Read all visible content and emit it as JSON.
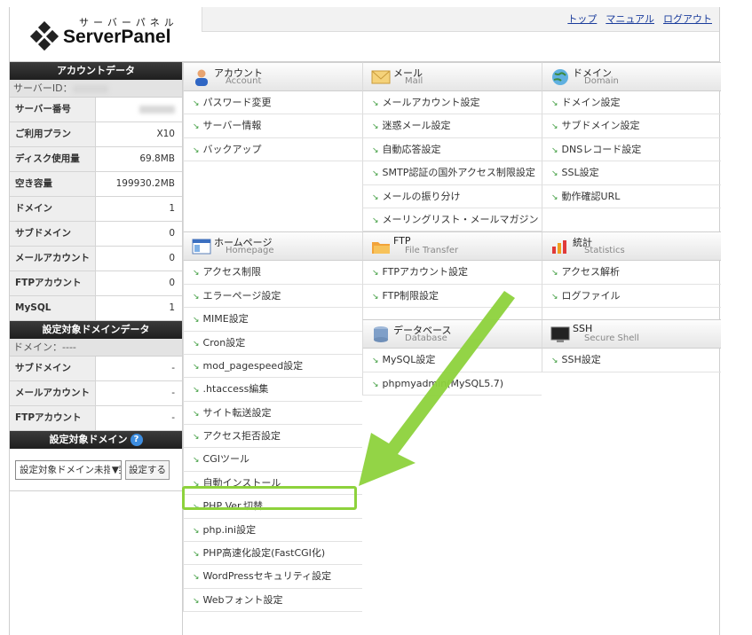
{
  "header": {
    "logo_kana": "サーバーパネル",
    "logo_text": "ServerPanel",
    "links": [
      "トップ",
      "マニュアル",
      "ログアウト"
    ]
  },
  "sidebar": {
    "account_title": "アカウントデータ",
    "server_id_label": "サーバーID：",
    "rows": [
      {
        "k": "サーバー番号",
        "v": ""
      },
      {
        "k": "ご利用プラン",
        "v": "X10"
      },
      {
        "k": "ディスク使用量",
        "v": "69.8MB"
      },
      {
        "k": "空き容量",
        "v": "199930.2MB"
      },
      {
        "k": "ドメイン",
        "v": "1"
      },
      {
        "k": "サブドメイン",
        "v": "0"
      },
      {
        "k": "メールアカウント",
        "v": "0"
      },
      {
        "k": "FTPアカウント",
        "v": "0"
      },
      {
        "k": "MySQL",
        "v": "1"
      }
    ],
    "domain_data_title": "設定対象ドメインデータ",
    "domain_label": "ドメイン：----",
    "domain_rows": [
      {
        "k": "サブドメイン",
        "v": "-"
      },
      {
        "k": "メールアカウント",
        "v": "-"
      },
      {
        "k": "FTPアカウント",
        "v": "-"
      }
    ],
    "target_domain_title": "設定対象ドメイン",
    "help": "?",
    "select_value": "設定対象ドメイン未指定",
    "select_arrow": "▼",
    "set_button": "設定する"
  },
  "columns": [
    {
      "sections": [
        {
          "title": "アカウント",
          "sub": "Account",
          "icon": "user-icon",
          "items": [
            "パスワード変更",
            "サーバー情報",
            "バックアップ"
          ],
          "pad": 3
        },
        {
          "title": "ホームページ",
          "sub": "Homepage",
          "icon": "homepage-icon",
          "items": [
            "アクセス制限",
            "エラーページ設定",
            "MIME設定",
            "Cron設定",
            "mod_pagespeed設定",
            ".htaccess編集",
            "サイト転送設定",
            "アクセス拒否設定",
            "CGIツール",
            "自動インストール",
            "PHP Ver.切替",
            "php.ini設定",
            "PHP高速化設定(FastCGI化)",
            "WordPressセキュリティ設定",
            "Webフォント設定"
          ],
          "pad": 0
        }
      ]
    },
    {
      "sections": [
        {
          "title": "メール",
          "sub": "Mail",
          "icon": "mail-icon",
          "items": [
            "メールアカウント設定",
            "迷惑メール設定",
            "自動応答設定",
            "SMTP認証の国外アクセス制限設定",
            "メールの振り分け",
            "メーリングリスト・メールマガジン"
          ],
          "pad": 0
        },
        {
          "title": "FTP",
          "sub": "File Transfer",
          "icon": "folder-icon",
          "items": [
            "FTPアカウント設定",
            "FTP制限設定"
          ],
          "pad": 0.5
        },
        {
          "title": "データベース",
          "sub": "Database",
          "icon": "database-icon",
          "items": [
            "MySQL設定",
            "phpmyadmin(MySQL5.7)"
          ],
          "pad": 0
        }
      ]
    },
    {
      "sections": [
        {
          "title": "ドメイン",
          "sub": "Domain",
          "icon": "globe-icon",
          "items": [
            "ドメイン設定",
            "サブドメイン設定",
            "DNSレコード設定",
            "SSL設定",
            "動作確認URL"
          ],
          "pad": 1
        },
        {
          "title": "統計",
          "sub": "Statistics",
          "icon": "stats-icon",
          "items": [
            "アクセス解析",
            "ログファイル"
          ],
          "pad": 0.5
        },
        {
          "title": "SSH",
          "sub": "Secure Shell",
          "icon": "ssh-icon",
          "items": [
            "SSH設定"
          ],
          "pad": 0
        }
      ]
    }
  ],
  "colors": {
    "highlight": "#8dd23c",
    "link": "#1a3c9c"
  }
}
